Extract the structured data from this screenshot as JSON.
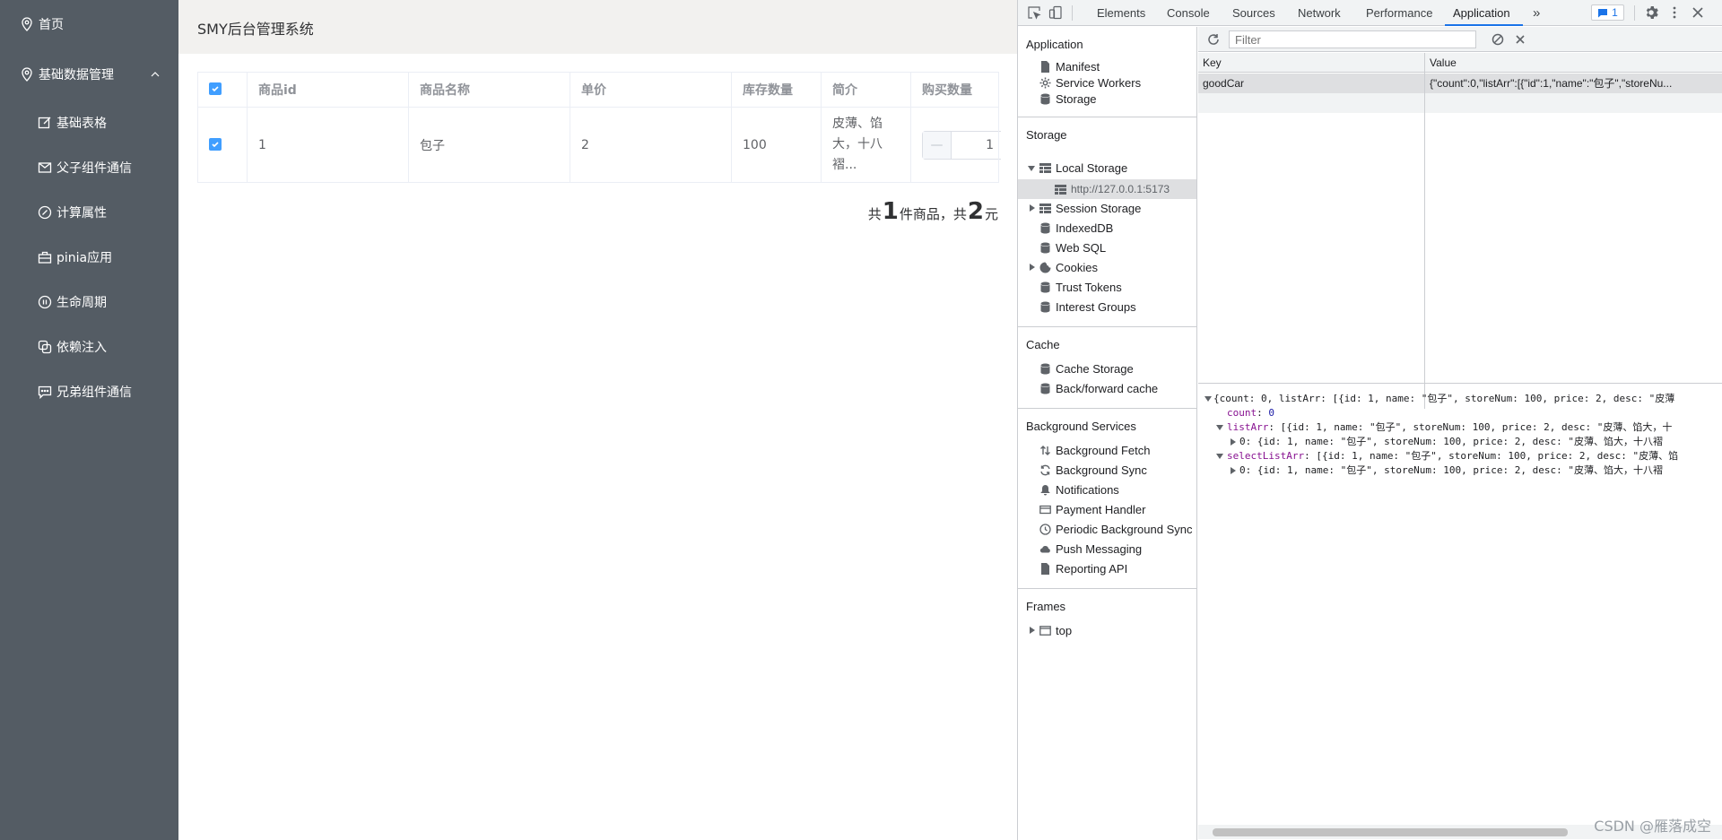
{
  "sidebar": {
    "items": [
      {
        "label": "首页",
        "icon": "location-icon"
      },
      {
        "label": "基础数据管理",
        "icon": "location-icon",
        "expanded": true
      },
      {
        "label": "基础表格",
        "icon": "edit-icon"
      },
      {
        "label": "父子组件通信",
        "icon": "message-icon"
      },
      {
        "label": "计算属性",
        "icon": "compass-icon"
      },
      {
        "label": "pinia应用",
        "icon": "briefcase-icon"
      },
      {
        "label": "生命周期",
        "icon": "pause-circle-icon"
      },
      {
        "label": "依赖注入",
        "icon": "copy-icon"
      },
      {
        "label": "兄弟组件通信",
        "icon": "chat-icon"
      }
    ]
  },
  "header": {
    "title": "SMY后台管理系统"
  },
  "table": {
    "columns": [
      "商品id",
      "商品名称",
      "单价",
      "库存数量",
      "简介",
      "购买数量"
    ],
    "rows": [
      {
        "id": "1",
        "name": "包子",
        "price": "2",
        "stock": "100",
        "desc": [
          "皮薄、馅",
          "大，十八",
          "褶..."
        ],
        "qty": "1",
        "checked": true
      }
    ],
    "header_checked": true,
    "stepper_minus": "—"
  },
  "summary": {
    "prefix": "共",
    "count": "1",
    "mid": "件商品，共",
    "total": "2",
    "suffix": "元"
  },
  "devtools": {
    "tabs": [
      "Elements",
      "Console",
      "Sources",
      "Network",
      "Performance",
      "Application"
    ],
    "active_tab": "Application",
    "more": "»",
    "badge": "1",
    "accent": "#1a73e8",
    "sections": {
      "application": {
        "title": "Application",
        "items": [
          "Manifest",
          "Service Workers",
          "Storage"
        ]
      },
      "storage": {
        "title": "Storage",
        "local_storage": "Local Storage",
        "origin": "http://127.0.0.1:5173",
        "items": [
          "Session Storage",
          "IndexedDB",
          "Web SQL",
          "Cookies",
          "Trust Tokens",
          "Interest Groups"
        ]
      },
      "cache": {
        "title": "Cache",
        "items": [
          "Cache Storage",
          "Back/forward cache"
        ]
      },
      "background": {
        "title": "Background Services",
        "items": [
          "Background Fetch",
          "Background Sync",
          "Notifications",
          "Payment Handler",
          "Periodic Background Sync",
          "Push Messaging",
          "Reporting API"
        ]
      },
      "frames": {
        "title": "Frames",
        "items": [
          "top"
        ]
      }
    },
    "filter_placeholder": "Filter",
    "kv": {
      "key_header": "Key",
      "value_header": "Value",
      "key": "goodCar",
      "value": "{\"count\":0,\"listArr\":[{\"id\":1,\"name\":\"包子\",\"storeNu..."
    },
    "preview": {
      "root": "{count: 0, listArr: [{id: 1, name: \"包子\", storeNum: 100, price: 2, desc: \"皮薄",
      "count_key": "count",
      "count_val": "0",
      "listArr_key": "listArr",
      "listArr_val": "[{id: 1, name: \"包子\", storeNum: 100, price: 2, desc: \"皮薄、馅大，十",
      "listArr_0": "0: {id: 1, name: \"包子\", storeNum: 100, price: 2, desc: \"皮薄、馅大，十八褶",
      "selectListArr_key": "selectListArr",
      "selectListArr_val": "[{id: 1, name: \"包子\", storeNum: 100, price: 2, desc: \"皮薄、馅",
      "selectListArr_0": "0: {id: 1, name: \"包子\", storeNum: 100, price: 2, desc: \"皮薄、馅大，十八褶"
    }
  },
  "watermark": "CSDN @雁落成空"
}
